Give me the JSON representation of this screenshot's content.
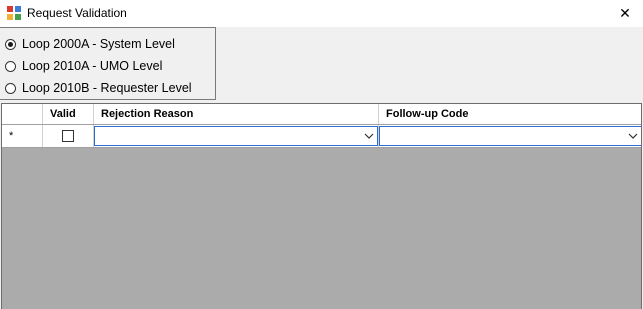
{
  "window": {
    "title": "Request Validation",
    "close_glyph": "✕"
  },
  "loop_options": [
    {
      "label": "Loop 2000A - System Level",
      "selected": true
    },
    {
      "label": "Loop 2010A - UMO Level",
      "selected": false
    },
    {
      "label": "Loop 2010B - Requester Level",
      "selected": false
    }
  ],
  "grid": {
    "columns": [
      {
        "label": ""
      },
      {
        "label": "Valid"
      },
      {
        "label": "Rejection Reason"
      },
      {
        "label": "Follow-up Code"
      }
    ],
    "new_row": {
      "marker": "*",
      "valid_checked": false,
      "rejection_reason": "",
      "followup_code": ""
    }
  },
  "colors": {
    "grid_background": "#ababab",
    "combo_border": "#2a6fd0"
  }
}
